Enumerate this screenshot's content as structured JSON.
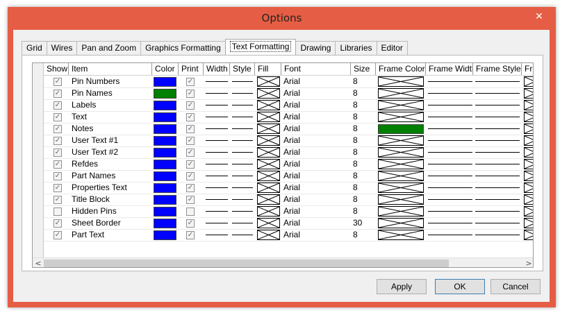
{
  "window": {
    "title": "Options",
    "close_glyph": "✕"
  },
  "tabs": [
    {
      "label": "Grid",
      "active": false
    },
    {
      "label": "Wires",
      "active": false
    },
    {
      "label": "Pan and Zoom",
      "active": false
    },
    {
      "label": "Graphics Formatting",
      "active": false
    },
    {
      "label": "Text Formatting",
      "active": true
    },
    {
      "label": "Drawing",
      "active": false
    },
    {
      "label": "Libraries",
      "active": false
    },
    {
      "label": "Editor",
      "active": false
    }
  ],
  "table": {
    "columns": [
      "Show",
      "Item",
      "Color",
      "Print",
      "Width",
      "Style",
      "Fill",
      "Font",
      "Size",
      "Frame Color",
      "Frame Width",
      "Frame Style",
      "Fr"
    ],
    "rows": [
      {
        "show": true,
        "item": "Pin Numbers",
        "color": "#0000ff",
        "print": true,
        "font": "Arial",
        "size": "8",
        "frame_color": "none"
      },
      {
        "show": true,
        "item": "Pin Names",
        "color": "#008000",
        "print": true,
        "font": "Arial",
        "size": "8",
        "frame_color": "none"
      },
      {
        "show": true,
        "item": "Labels",
        "color": "#0000ff",
        "print": true,
        "font": "Arial",
        "size": "8",
        "frame_color": "none"
      },
      {
        "show": true,
        "item": "Text",
        "color": "#0000ff",
        "print": true,
        "font": "Arial",
        "size": "8",
        "frame_color": "none"
      },
      {
        "show": true,
        "item": "Notes",
        "color": "#0000ff",
        "print": true,
        "font": "Arial",
        "size": "8",
        "frame_color": "#008000"
      },
      {
        "show": true,
        "item": "User Text #1",
        "color": "#0000ff",
        "print": true,
        "font": "Arial",
        "size": "8",
        "frame_color": "none"
      },
      {
        "show": true,
        "item": "User Text #2",
        "color": "#0000ff",
        "print": true,
        "font": "Arial",
        "size": "8",
        "frame_color": "none"
      },
      {
        "show": true,
        "item": "Refdes",
        "color": "#0000ff",
        "print": true,
        "font": "Arial",
        "size": "8",
        "frame_color": "none"
      },
      {
        "show": true,
        "item": "Part Names",
        "color": "#0000ff",
        "print": true,
        "font": "Arial",
        "size": "8",
        "frame_color": "none"
      },
      {
        "show": true,
        "item": "Properties Text",
        "color": "#0000ff",
        "print": true,
        "font": "Arial",
        "size": "8",
        "frame_color": "none"
      },
      {
        "show": true,
        "item": "Title Block",
        "color": "#0000ff",
        "print": true,
        "font": "Arial",
        "size": "8",
        "frame_color": "none"
      },
      {
        "show": false,
        "item": "Hidden Pins",
        "color": "#0000ff",
        "print": false,
        "font": "Arial",
        "size": "8",
        "frame_color": "none"
      },
      {
        "show": true,
        "item": "Sheet Border",
        "color": "#0000ff",
        "print": true,
        "font": "Arial",
        "size": "30",
        "frame_color": "none"
      },
      {
        "show": true,
        "item": "Part Text",
        "color": "#0000ff",
        "print": true,
        "font": "Arial",
        "size": "8",
        "frame_color": "none"
      }
    ]
  },
  "scrollbar": {
    "left_glyph": "<",
    "right_glyph": ">"
  },
  "buttons": {
    "apply": "Apply",
    "ok": "OK",
    "cancel": "Cancel"
  },
  "icons": {
    "check": "✓",
    "close": "close-icon"
  }
}
